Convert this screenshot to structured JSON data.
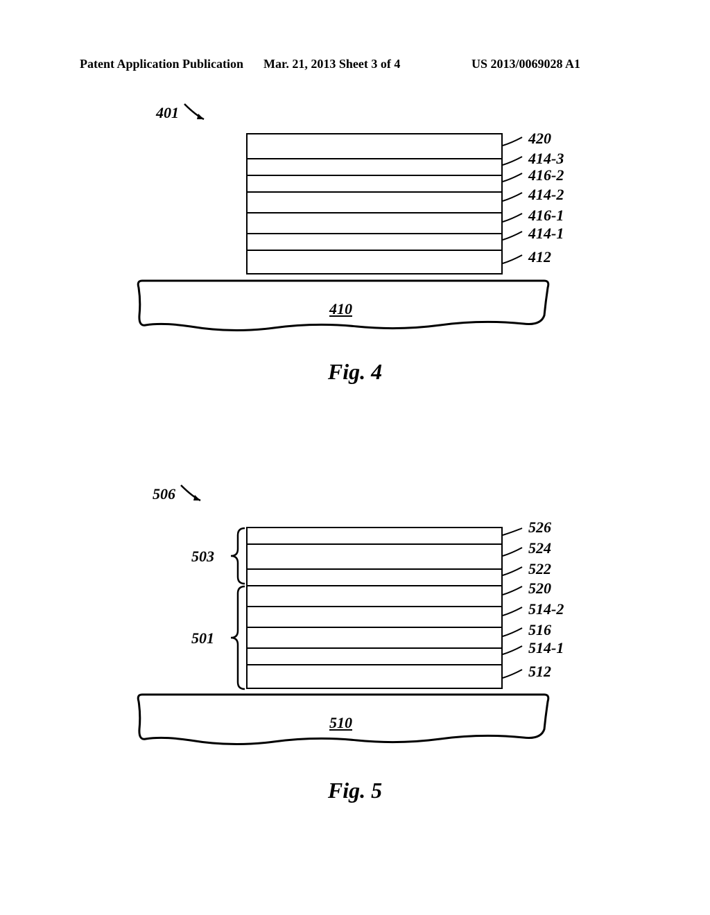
{
  "header": {
    "left": "Patent Application Publication",
    "center": "Mar. 21, 2013  Sheet 3 of 4",
    "right": "US 2013/0069028 A1"
  },
  "fig4": {
    "ref_top": "401",
    "labels": [
      "420",
      "414-3",
      "416-2",
      "414-2",
      "416-1",
      "414-1",
      "412"
    ],
    "substrate": "410",
    "caption": "Fig. 4"
  },
  "fig5": {
    "ref_top": "506",
    "brace_top": "503",
    "brace_bot": "501",
    "labels": [
      "526",
      "524",
      "522",
      "520",
      "514-2",
      "516",
      "514-1",
      "512"
    ],
    "substrate": "510",
    "caption": "Fig. 5"
  }
}
